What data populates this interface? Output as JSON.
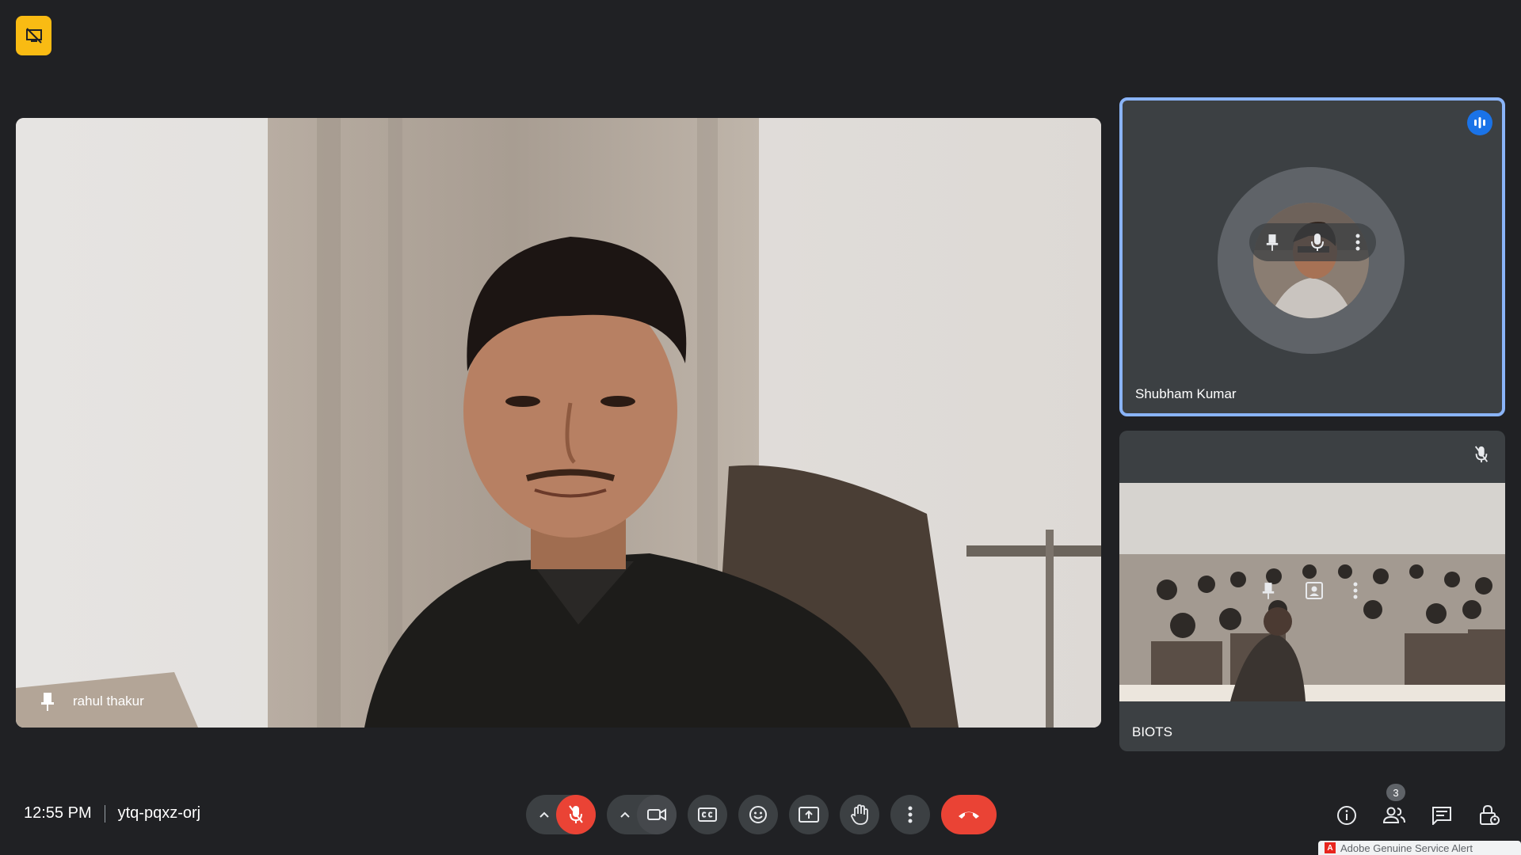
{
  "meeting": {
    "time": "12:55 PM",
    "code": "ytq-pqxz-orj"
  },
  "main_tile": {
    "participant_name": "rahul thakur"
  },
  "side_tiles": [
    {
      "participant_name": "Shubham Kumar",
      "state": "speaking"
    },
    {
      "participant_name": "BIOTS",
      "state": "muted"
    }
  ],
  "controls": {
    "mic_state": "muted",
    "camera_state": "on"
  },
  "people_count": "3",
  "notification": {
    "text": "Adobe Genuine Service Alert",
    "icon_letter": "A"
  },
  "colors": {
    "background": "#202124",
    "accent_blue": "#8ab4f8",
    "danger_red": "#ea4335",
    "badge_yellow": "#f9bb13"
  }
}
